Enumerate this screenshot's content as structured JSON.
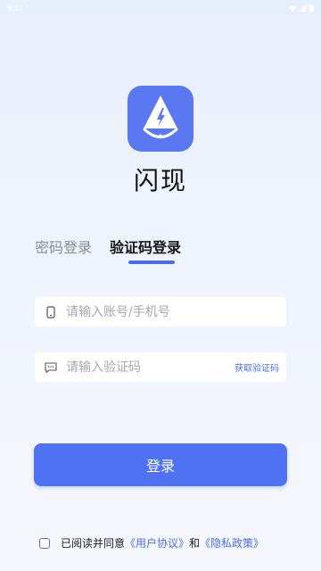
{
  "status_bar": {
    "time": "9:37"
  },
  "app": {
    "name": "闪现"
  },
  "tabs": [
    {
      "label": "密码登录",
      "active": false
    },
    {
      "label": "验证码登录",
      "active": true
    }
  ],
  "form": {
    "account_placeholder": "请输入账号/手机号",
    "code_placeholder": "请输入验证码",
    "get_code_label": "获取验证码"
  },
  "login_button": {
    "label": "登录"
  },
  "agreement": {
    "prefix": "已阅读并同意",
    "user_agreement": "《用户协议》",
    "and": "和",
    "privacy_policy": "《隐私政策》"
  },
  "colors": {
    "accent": "#4f72f5",
    "logo_bg": "#5b78f3",
    "link": "#4a6cf3"
  },
  "icons": [
    "wifi-icon",
    "signal-icon",
    "battery-icon",
    "app-logo-icon",
    "phone-icon",
    "message-icon",
    "checkbox-icon"
  ]
}
